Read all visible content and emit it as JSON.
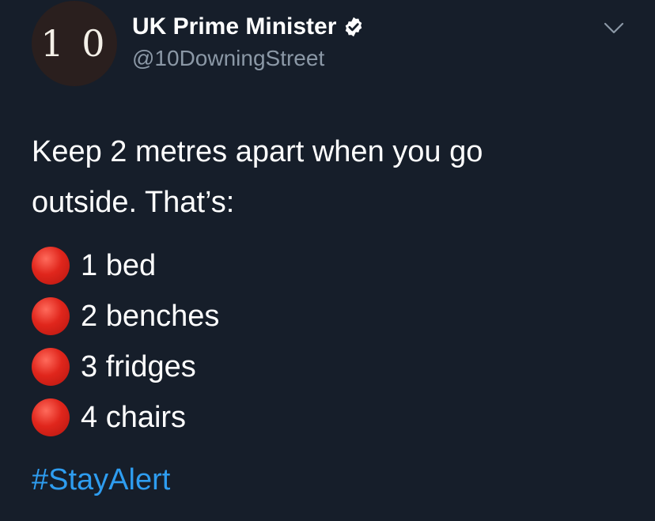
{
  "author": {
    "avatar_text": "1 0",
    "display_name": "UK Prime Minister",
    "verified_icon": "verified-badge-icon",
    "handle": "@10DowningStreet"
  },
  "menu_icon": "chevron-down-icon",
  "tweet": {
    "lines": [
      "Keep 2 metres apart when you go",
      "outside. That’s:"
    ],
    "bullet_icon": "red-circle-icon",
    "items": [
      "1 bed",
      "2 benches",
      "3 fridges",
      "4 chairs"
    ],
    "hashtag": "#StayAlert"
  },
  "colors": {
    "background": "#161e2a",
    "text": "#ffffff",
    "secondary": "#8b98a6",
    "link": "#2e9df0",
    "bullet": "#e0261c"
  }
}
